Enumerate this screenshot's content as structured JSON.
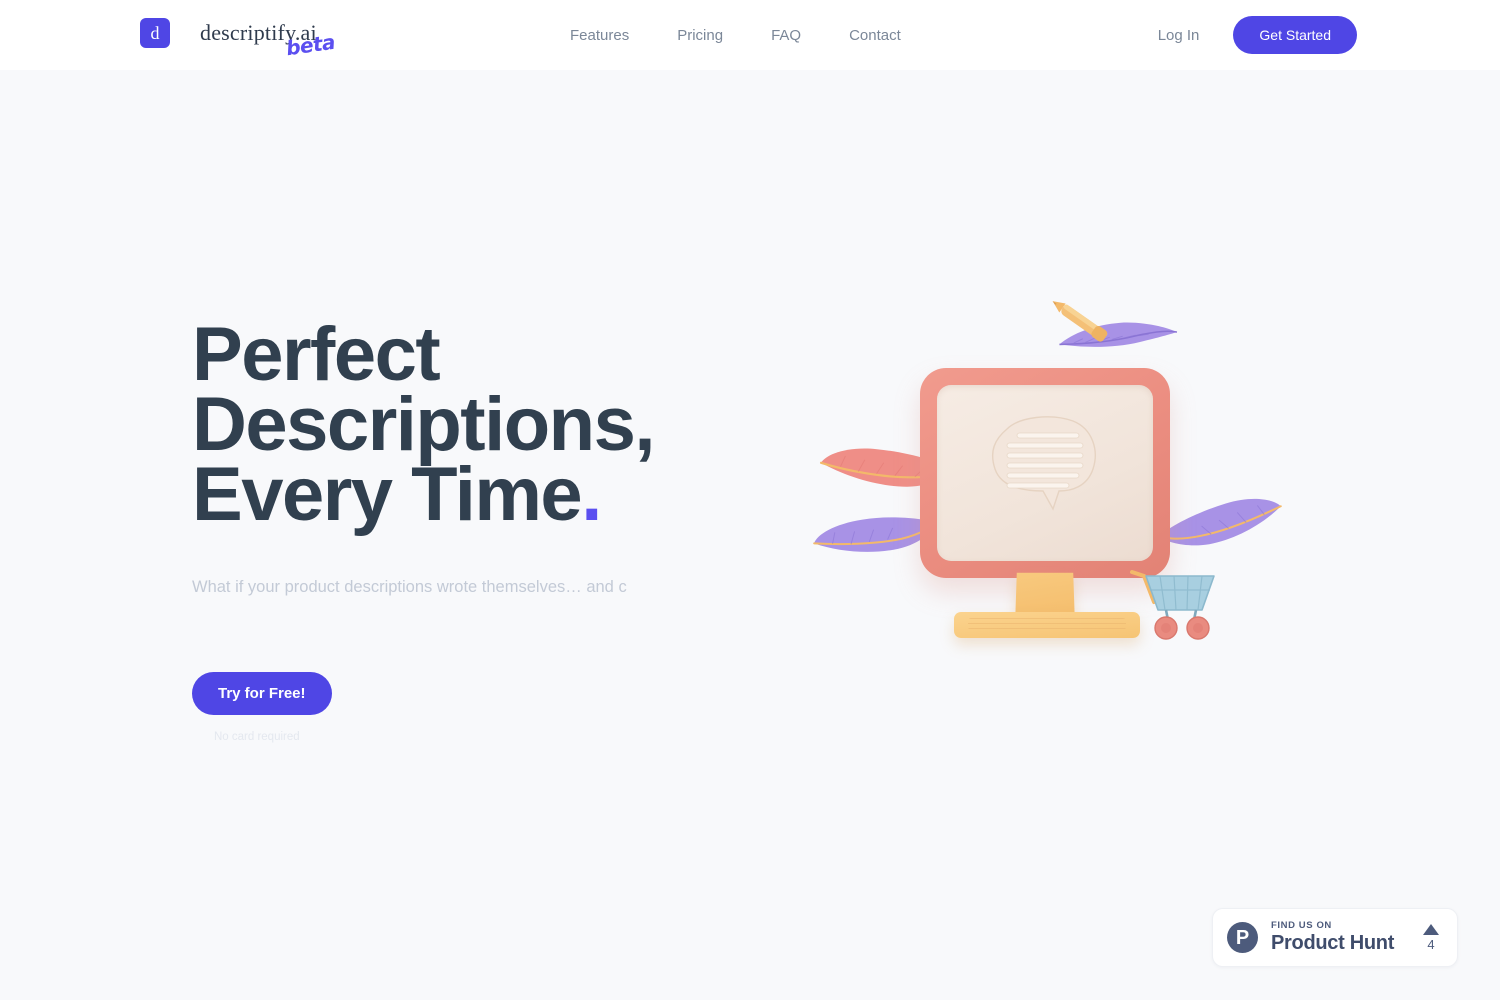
{
  "header": {
    "brand": {
      "mark_letter": "d",
      "name": "descriptify.ai",
      "badge": "beta"
    },
    "nav": [
      {
        "label": "Features"
      },
      {
        "label": "Pricing"
      },
      {
        "label": "FAQ"
      },
      {
        "label": "Contact"
      }
    ],
    "login_label": "Log In",
    "get_started_label": "Get Started"
  },
  "hero": {
    "headline_line1": "Perfect",
    "headline_line2": "Descriptions,",
    "headline_line3": "Every Time",
    "headline_dot": ".",
    "subhead": "What if your product descriptions wrote themselves… and c",
    "cta_label": "Try for Free!",
    "cta_note": "No card required"
  },
  "illustration": {
    "name": "3d-monitor-with-feathers-and-cart",
    "elements": [
      "monitor",
      "speech-bubble",
      "keyboard",
      "stand",
      "feather-purple-top",
      "feather-purple-left",
      "feather-coral-left",
      "feather-purple-right",
      "gold-pen",
      "shopping-cart"
    ]
  },
  "product_hunt": {
    "find_us_on": "FIND US ON",
    "name": "Product Hunt",
    "count": "4",
    "logo_letter": "P"
  },
  "colors": {
    "accent": "#4f46e5",
    "headline": "#31404f",
    "nav_text": "#7b8798",
    "page_bg": "#f8f9fb",
    "header_bg": "#ffffff",
    "product_hunt": "#4d5b7c",
    "monitor": "#ec8f82",
    "keyboard": "#f6c474",
    "feather_purple": "#9f8ae0",
    "feather_coral": "#ef8e87",
    "cart": "#a8cfe0"
  }
}
